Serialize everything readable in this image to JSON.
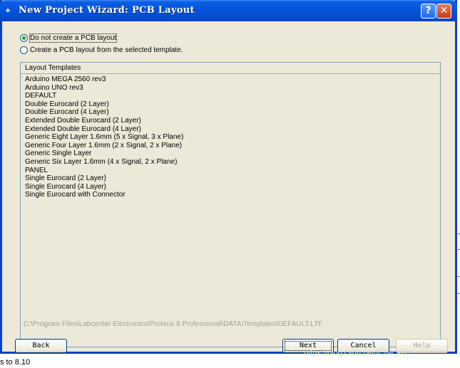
{
  "window": {
    "title": "New Project Wizard: PCB Layout",
    "help_button": "?",
    "close_button": "✕"
  },
  "options": [
    {
      "label": "Do not create a PCB layout",
      "checked": true
    },
    {
      "label": "Create a PCB layout from the selected template.",
      "checked": false
    }
  ],
  "templates": {
    "header": "Layout Templates",
    "items": [
      "Arduino MEGA 2560 rev3",
      "Arduino UNO rev3",
      "DEFAULT",
      "Double Eurocard (2 Layer)",
      "Double Eurocard (4 Layer)",
      "Extended Double Eurocard (2 Layer)",
      "Extended Double Eurocard (4 Layer)",
      "Generic Eight Layer 1.6mm (5 x Signal, 3 x Plane)",
      "Generic Four Layer 1.6mm (2 x Signal, 2 x Plane)",
      "Generic Single Layer",
      "Generic Six Layer 1.6mm (4 x Signal, 2 x Plane)",
      "PANEL",
      "Single Eurocard (2 Layer)",
      "Single Eurocard (4 Layer)",
      "Single Eurocard with Connector"
    ],
    "path": "C:\\Program Files\\Labcenter Electronics\\Proteus 8 Professional\\DATA\\Templates\\DEFAULT.LTF"
  },
  "buttons": {
    "back": "Back",
    "next": "Next",
    "cancel": "Cancel",
    "help": "Help"
  },
  "watermark": "https://blog.csdn.net/fl_de_ku",
  "background": {
    "bottom_text": "s to 8.10"
  }
}
